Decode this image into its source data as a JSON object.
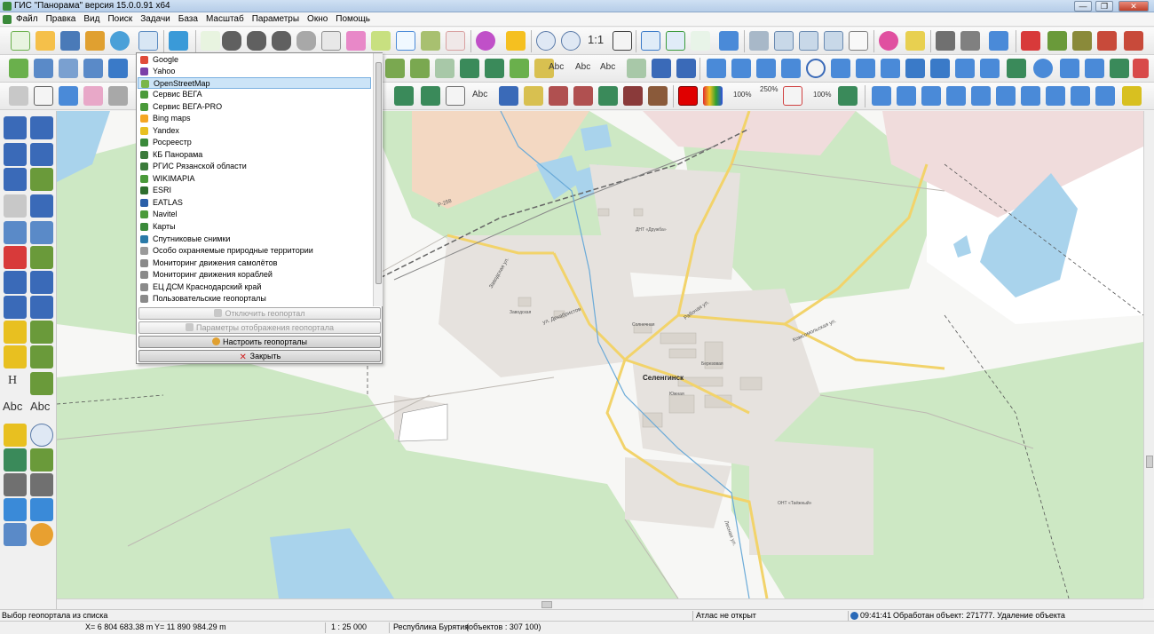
{
  "window": {
    "title": "ГИС \"Панорама\" версия 15.0.0.91 x64",
    "controls": {
      "minimize": "—",
      "maximize": "❐",
      "close": "✕"
    }
  },
  "menubar": {
    "items": [
      "Файл",
      "Правка",
      "Вид",
      "Поиск",
      "Задачи",
      "База",
      "Масштаб",
      "Параметры",
      "Окно",
      "Помощь"
    ]
  },
  "toolbar": {
    "scale_label": "1:1",
    "abc_labels": [
      "Abc",
      "Abc",
      "Abc",
      "Abc"
    ],
    "zoom_100": "100%",
    "zoom_250": "250%",
    "zoom_100b": "100%"
  },
  "lefttools": {
    "h_label": "H",
    "abc_left": "Abc",
    "abc_right": "Abc"
  },
  "geoportal_menu": {
    "items": [
      {
        "label": "Google",
        "icon": "google-icon",
        "color": "#e04b3a"
      },
      {
        "label": "Yahoo",
        "icon": "yahoo-icon",
        "color": "#7b3fa8"
      },
      {
        "label": "OpenStreetMap",
        "icon": "osm-icon",
        "color": "#7ab648",
        "selected": true
      },
      {
        "label": "Сервис ВЕГА",
        "icon": "vega-icon",
        "color": "#4a9a3a"
      },
      {
        "label": "Сервис ВЕГА-PRO",
        "icon": "vega-pro-icon",
        "color": "#4a9a3a"
      },
      {
        "label": "Bing maps",
        "icon": "bing-icon",
        "color": "#f5a623"
      },
      {
        "label": "Yandex",
        "icon": "yandex-icon",
        "color": "#e8c020"
      },
      {
        "label": "Росреестр",
        "icon": "rosreestr-icon",
        "color": "#3a8a3a"
      },
      {
        "label": "КБ Панорама",
        "icon": "panorama-icon",
        "color": "#3a7a3a"
      },
      {
        "label": "РГИС Рязанской области",
        "icon": "rgis-icon",
        "color": "#3a7a3a"
      },
      {
        "label": "WIKIMAPIA",
        "icon": "wikimapia-icon",
        "color": "#4a9a3a"
      },
      {
        "label": "ESRI",
        "icon": "esri-icon",
        "color": "#2e6e2e"
      },
      {
        "label": "EATLAS",
        "icon": "eatlas-icon",
        "color": "#2a5fa8"
      },
      {
        "label": "Navitel",
        "icon": "navitel-icon",
        "color": "#4a9a3a"
      },
      {
        "label": "Карты",
        "icon": "maps-icon",
        "color": "#3a8a3a"
      },
      {
        "label": "Спутниковые снимки",
        "icon": "satellite-icon",
        "color": "#2a7aa8"
      },
      {
        "label": "Особо охраняемые природные территории",
        "icon": "nature-reserve-icon",
        "color": "#9a9a9a"
      },
      {
        "label": "Мониторинг движения самолётов",
        "icon": "plane-monitoring-icon",
        "color": "#8a8a8a"
      },
      {
        "label": "Мониторинг движения кораблей",
        "icon": "ship-monitoring-icon",
        "color": "#8a8a8a"
      },
      {
        "label": "ЕЦ ДСМ Краснодарский край",
        "icon": "ec-dsm-icon",
        "color": "#8a8a8a"
      },
      {
        "label": "Пользовательские геопорталы",
        "icon": "user-geoportals-icon",
        "color": "#8a8a8a"
      }
    ],
    "disable_button": "Отключить геопортал",
    "display_params_button": "Параметры отображения геопортала",
    "configure_button": "Настроить геопорталы",
    "close_button": "Закрыть"
  },
  "map": {
    "town_label": "Селенгинск",
    "labels": [
      "Р-258",
      "Рабочая ул.",
      "Комсомольская ул.",
      "ДНТ «Дружба»",
      "ОНТ «Таёжный»",
      "ул. Декабристов",
      "Заводская ул.",
      "Заводская",
      "Солнечная",
      "Березовая",
      "Южная",
      "Лесная ул."
    ],
    "colors": {
      "forest": "#cde8c4",
      "water": "#a9d3ec",
      "road_major": "#f2d36a",
      "road_minor": "#ffffff",
      "building": "#d9d4cd",
      "residential": "#e6e2de",
      "pink_zone": "#f0dcdc",
      "orange_zone": "#f3d8c2"
    }
  },
  "status": {
    "hint": "Выбор геопортала из списка",
    "atlas": "Атлас не открыт",
    "time": "09:41:41",
    "processed": "Обработан объект: 271777. Удаление объекта",
    "x_coord": "X= 6 804 683.38 m",
    "y_coord": "Y= 11 890 984.29 m",
    "scale": "1 : 25 000",
    "region": "Республика Бурятия",
    "objects": "(объектов : 307 100)"
  }
}
